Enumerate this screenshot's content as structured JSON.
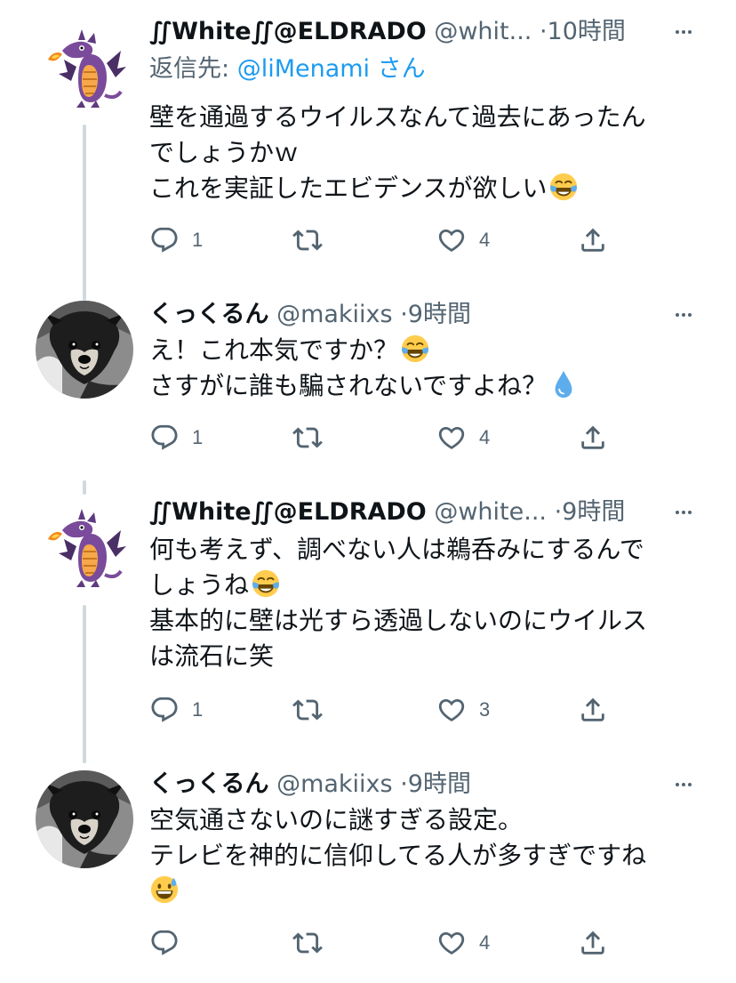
{
  "tweets": [
    {
      "display_name": "∬White∬@ELDRADO",
      "handle": "@whit...",
      "time": "·10時間",
      "reply_prefix": "返信先: ",
      "reply_mention": "@liMenami",
      "reply_suffix": " さん",
      "lines": [
        "壁を通過するウイルスなんて過去にあったん",
        "でしょうかｗ",
        "これを実証したエビデンスが欲しい"
      ],
      "reply_count": "1",
      "retweet_count": "",
      "like_count": "4"
    },
    {
      "display_name": "くっくるん",
      "handle": "@makiixs",
      "time": "·9時間",
      "lines": [
        "え！これ本気ですか？",
        "さすがに誰も騙されないですよね？"
      ],
      "reply_count": "1",
      "retweet_count": "",
      "like_count": "4"
    },
    {
      "display_name": "∬White∬@ELDRADO",
      "handle": "@white...",
      "time": "·9時間",
      "lines": [
        "何も考えず、調べない人は鵜呑みにするんで",
        "しょうね",
        "基本的に壁は光すら透過しないのにウイルス",
        "は流石に笑"
      ],
      "reply_count": "1",
      "retweet_count": "",
      "like_count": "3"
    },
    {
      "display_name": "くっくるん",
      "handle": "@makiixs",
      "time": "·9時間",
      "lines": [
        "空気通さないのに謎すぎる設定。",
        "テレビを神的に信仰してる人が多すぎですね",
        ""
      ],
      "reply_count": "",
      "retweet_count": "",
      "like_count": "4"
    }
  ],
  "icons": {
    "more": "more-icon",
    "reply": "reply-icon",
    "retweet": "retweet-icon",
    "like": "like-icon",
    "share": "share-icon",
    "emoji_laugh": "tears-of-joy-emoji",
    "emoji_drop": "droplet-emoji",
    "emoji_sweat": "grinning-sweat-emoji"
  },
  "colors": {
    "text": "#0f1419",
    "secondary": "#536471",
    "link": "#1d9bf0",
    "thread_line": "#cfd9de"
  }
}
